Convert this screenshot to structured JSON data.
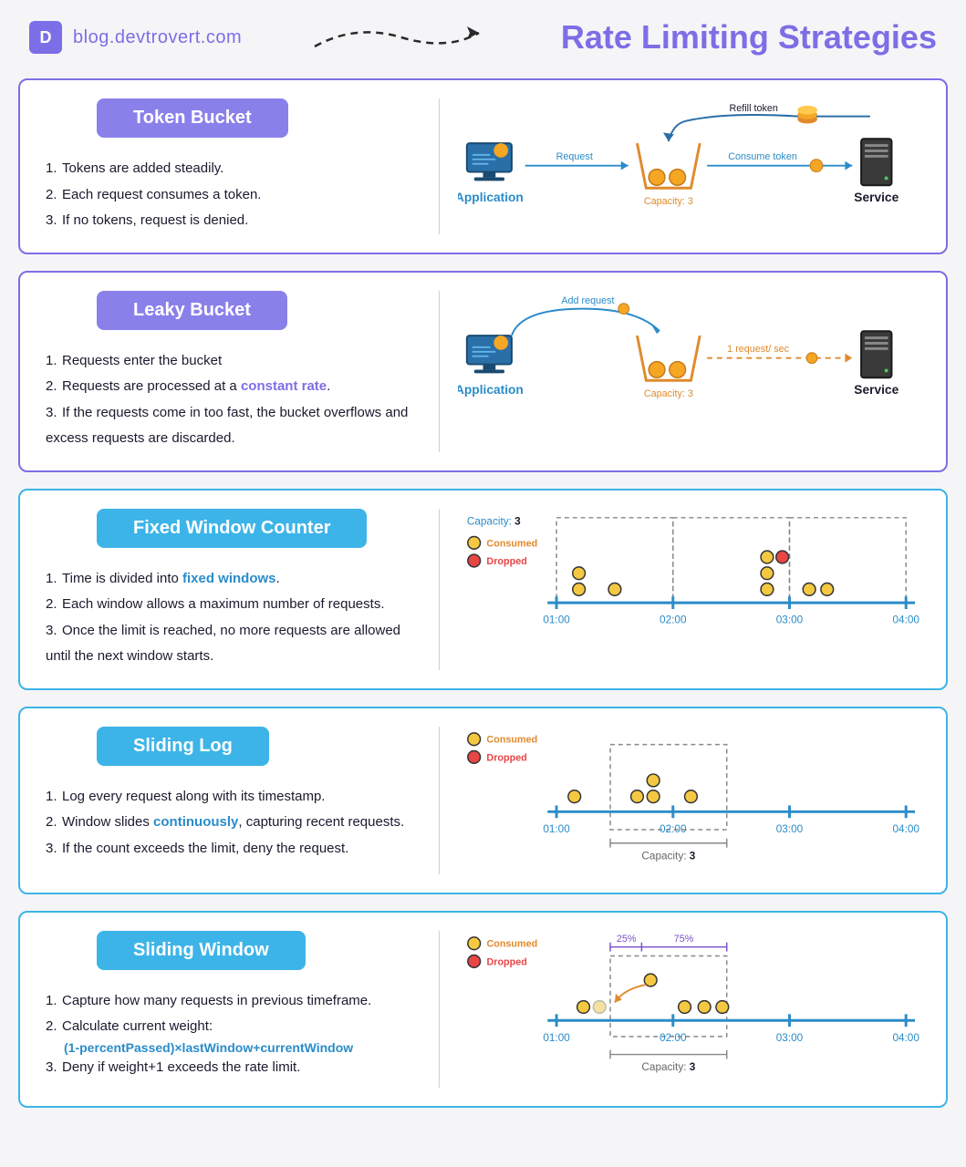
{
  "header": {
    "domain": "blog.devtrovert.com",
    "title": "Rate Limiting Strategies",
    "logo_letter": "D"
  },
  "sections": [
    {
      "title": "Token Bucket",
      "steps": [
        "Tokens are added steadily.",
        "Each request consumes a token.",
        "If no tokens, request is denied."
      ],
      "diagram": {
        "left_label": "Application",
        "request_label": "Request",
        "refill_label": "Refill token",
        "capacity_label": "Capacity: 3",
        "consume_label": "Consume token",
        "right_label": "Service"
      }
    },
    {
      "title": "Leaky Bucket",
      "steps_parts": [
        [
          "Requests enter the bucket"
        ],
        [
          "Requests are processed at a ",
          {
            "text": "constant rate",
            "cls": "highlight-purple"
          },
          "."
        ],
        [
          "If the requests come in too fast, the bucket overflows and excess requests are discarded."
        ]
      ],
      "diagram": {
        "left_label": "Application",
        "add_label": "Add request",
        "capacity_label": "Capacity: 3",
        "rate_label": "1 request/ sec",
        "right_label": "Service"
      }
    },
    {
      "title": "Fixed Window Counter",
      "steps_parts": [
        [
          "Time is divided into ",
          {
            "text": "fixed windows",
            "cls": "highlight-blue"
          },
          "."
        ],
        [
          "Each window allows a maximum number of requests."
        ],
        [
          "Once the limit is reached, no more requests are allowed until the next window starts."
        ]
      ],
      "diagram": {
        "capacity_label": "Capacity:",
        "capacity_value": "3",
        "legend_consumed": "Consumed",
        "legend_dropped": "Dropped",
        "times": [
          "01:00",
          "02:00",
          "03:00",
          "04:00"
        ]
      }
    },
    {
      "title": "Sliding Log",
      "steps_parts": [
        [
          "Log every request along with its timestamp."
        ],
        [
          "Window slides ",
          {
            "text": "continuously",
            "cls": "highlight-blue"
          },
          ", capturing recent requests."
        ],
        [
          "If the count exceeds the limit, deny the request."
        ]
      ],
      "diagram": {
        "legend_consumed": "Consumed",
        "legend_dropped": "Dropped",
        "times": [
          "01:00",
          "02:00",
          "03:00",
          "04:00"
        ],
        "capacity_label": "Capacity:",
        "capacity_value": "3"
      }
    },
    {
      "title": "Sliding Window",
      "steps_parts": [
        [
          "Capture how many requests in previous timeframe."
        ],
        [
          "Calculate current weight:"
        ],
        [
          "Deny if weight+1 exceeds the rate limit."
        ]
      ],
      "formula": "(1-percentPassed)×lastWindow+currentWindow",
      "diagram": {
        "legend_consumed": "Consumed",
        "legend_dropped": "Dropped",
        "pct1": "25%",
        "pct2": "75%",
        "times": [
          "01:00",
          "02:00",
          "03:00",
          "04:00"
        ],
        "capacity_label": "Capacity:",
        "capacity_value": "3"
      }
    }
  ]
}
